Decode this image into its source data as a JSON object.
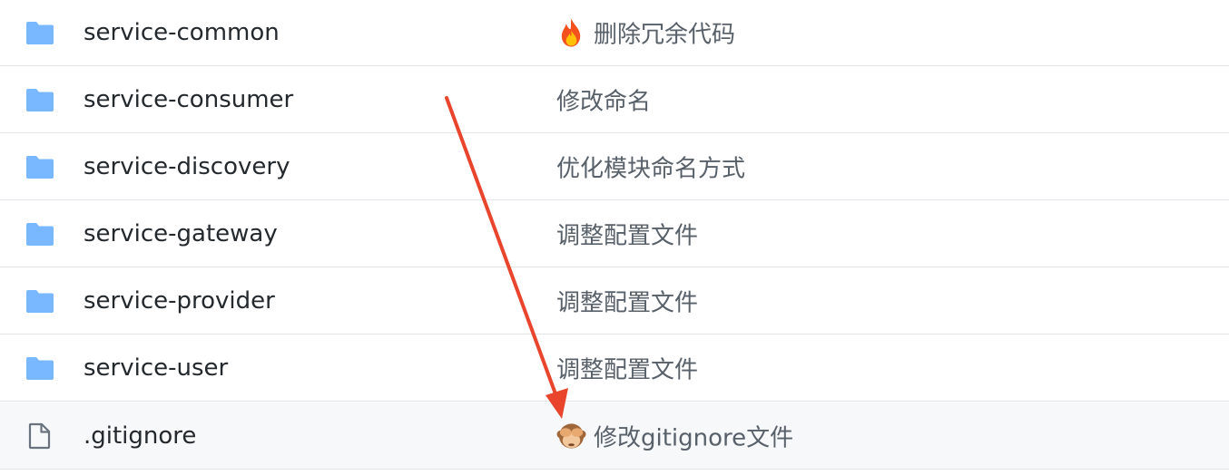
{
  "files": [
    {
      "name": "service-common",
      "type": "folder",
      "icon": "folder-icon",
      "message": "删除冗余代码",
      "emoji": "fire-emoji"
    },
    {
      "name": "service-consumer",
      "type": "folder",
      "icon": "folder-icon",
      "message": "修改命名",
      "emoji": ""
    },
    {
      "name": "service-discovery",
      "type": "folder",
      "icon": "folder-icon",
      "message": "优化模块命名方式",
      "emoji": ""
    },
    {
      "name": "service-gateway",
      "type": "folder",
      "icon": "folder-icon",
      "message": "调整配置文件",
      "emoji": ""
    },
    {
      "name": "service-provider",
      "type": "folder",
      "icon": "folder-icon",
      "message": "调整配置文件",
      "emoji": ""
    },
    {
      "name": "service-user",
      "type": "folder",
      "icon": "folder-icon",
      "message": "调整配置文件",
      "emoji": ""
    },
    {
      "name": ".gitignore",
      "type": "file",
      "icon": "file-icon",
      "message": "修改gitignore文件",
      "emoji": "see-no-evil-monkey-emoji"
    }
  ],
  "colors": {
    "folder": "#79b8ff",
    "file_icon": "#6a737d",
    "name_text": "#24292e",
    "message_text": "#586069",
    "row_border": "#e1e4e8",
    "highlight_row": "#f6f8fa",
    "arrow": "#e8452c"
  }
}
